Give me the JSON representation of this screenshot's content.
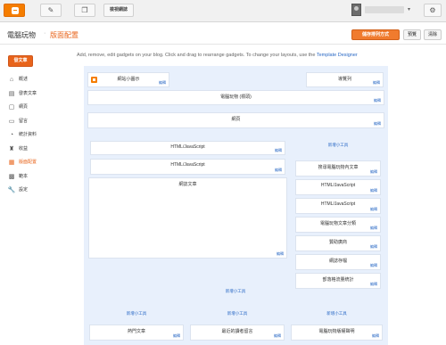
{
  "topbar": {
    "logo_icon": "blogger-logo-icon",
    "pencil_icon": "✎",
    "pages_icon": "❐",
    "view_blog_label": "檢視網誌",
    "gear_icon": "⚙",
    "user_caret": "▾"
  },
  "header": {
    "blog_title": "電腦玩物",
    "separator": "·",
    "page_title": "版面配置",
    "save_label": "儲存排列方式",
    "preview_label": "預覽",
    "clear_label": "清除"
  },
  "sidebar": {
    "new_post_label": "發文章",
    "items": [
      {
        "icon": "⌂",
        "label": "概述"
      },
      {
        "icon": "▤",
        "label": "發表文章"
      },
      {
        "icon": "▢",
        "label": "網頁"
      },
      {
        "icon": "▭",
        "label": "留言"
      },
      {
        "icon": "◔",
        "label": "統計資料"
      },
      {
        "icon": "♜",
        "label": "收益"
      },
      {
        "icon": "▦",
        "label": "版面配置"
      },
      {
        "icon": "▩",
        "label": "範本"
      },
      {
        "icon": "🔧",
        "label": "設定"
      }
    ]
  },
  "main": {
    "intro_text": "Add, remove, edit gadgets on your blog. Click and drag to rearrange gadgets. To change your layouts, use the",
    "intro_link": "Template Designer",
    "edit_label": "編輯",
    "add_gadget_label": "新增小工具",
    "favicon_label": "網站小圖示",
    "navbar_label": "導覽列",
    "header_gadget_label": "電腦玩物 (標頭)",
    "pages_label": "網頁",
    "html1_label": "HTML/JavaScript",
    "html2_label": "HTML/JavaScript",
    "blog_posts_label": "網誌文章",
    "sidebar_gadgets": [
      "搜尋電腦玩物內文章",
      "HTML/JavaScript",
      "HTML/JavaScript",
      "電腦玩物文章分類",
      "贊助廣商",
      "網誌存檔",
      "部落格流量統計"
    ],
    "footer_gadgets": [
      "熱門文章",
      "最近的讀者留言",
      "電腦玩物版權聲明"
    ]
  }
}
